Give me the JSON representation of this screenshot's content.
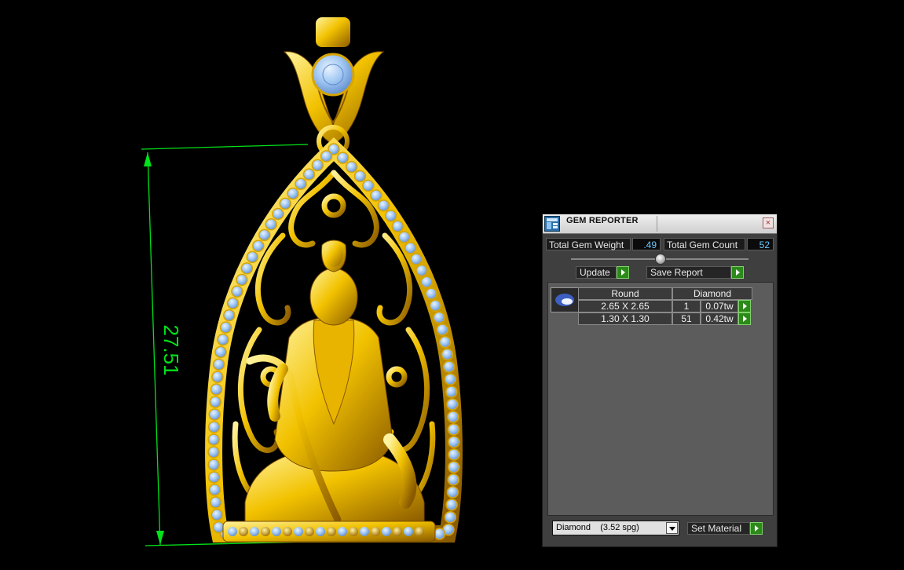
{
  "dimension": {
    "label": "27.51",
    "color": "#00e21a"
  },
  "gem_reporter": {
    "title": "GEM REPORTER",
    "close_glyph": "×",
    "total_weight_label": "Total Gem Weight",
    "total_weight_value": ".49",
    "total_count_label": "Total Gem Count",
    "total_count_value": "52",
    "update_label": "Update",
    "save_report_label": "Save Report",
    "table": {
      "shape": "Round",
      "material": "Diamond",
      "rows": [
        {
          "size": "2.65 X 2.65",
          "count": "1",
          "weight": "0.07tw"
        },
        {
          "size": "1.30 X 1.30",
          "count": "51",
          "weight": "0.42tw"
        }
      ]
    },
    "material_select": {
      "value": "Diamond    (3.52 spg)"
    },
    "set_material_label": "Set Material",
    "colors": {
      "accent_green": "#2c8a1a",
      "value_blue": "#6cc9ff",
      "gem_blue": "#9fc6f2",
      "gold": "#f2c200"
    }
  }
}
